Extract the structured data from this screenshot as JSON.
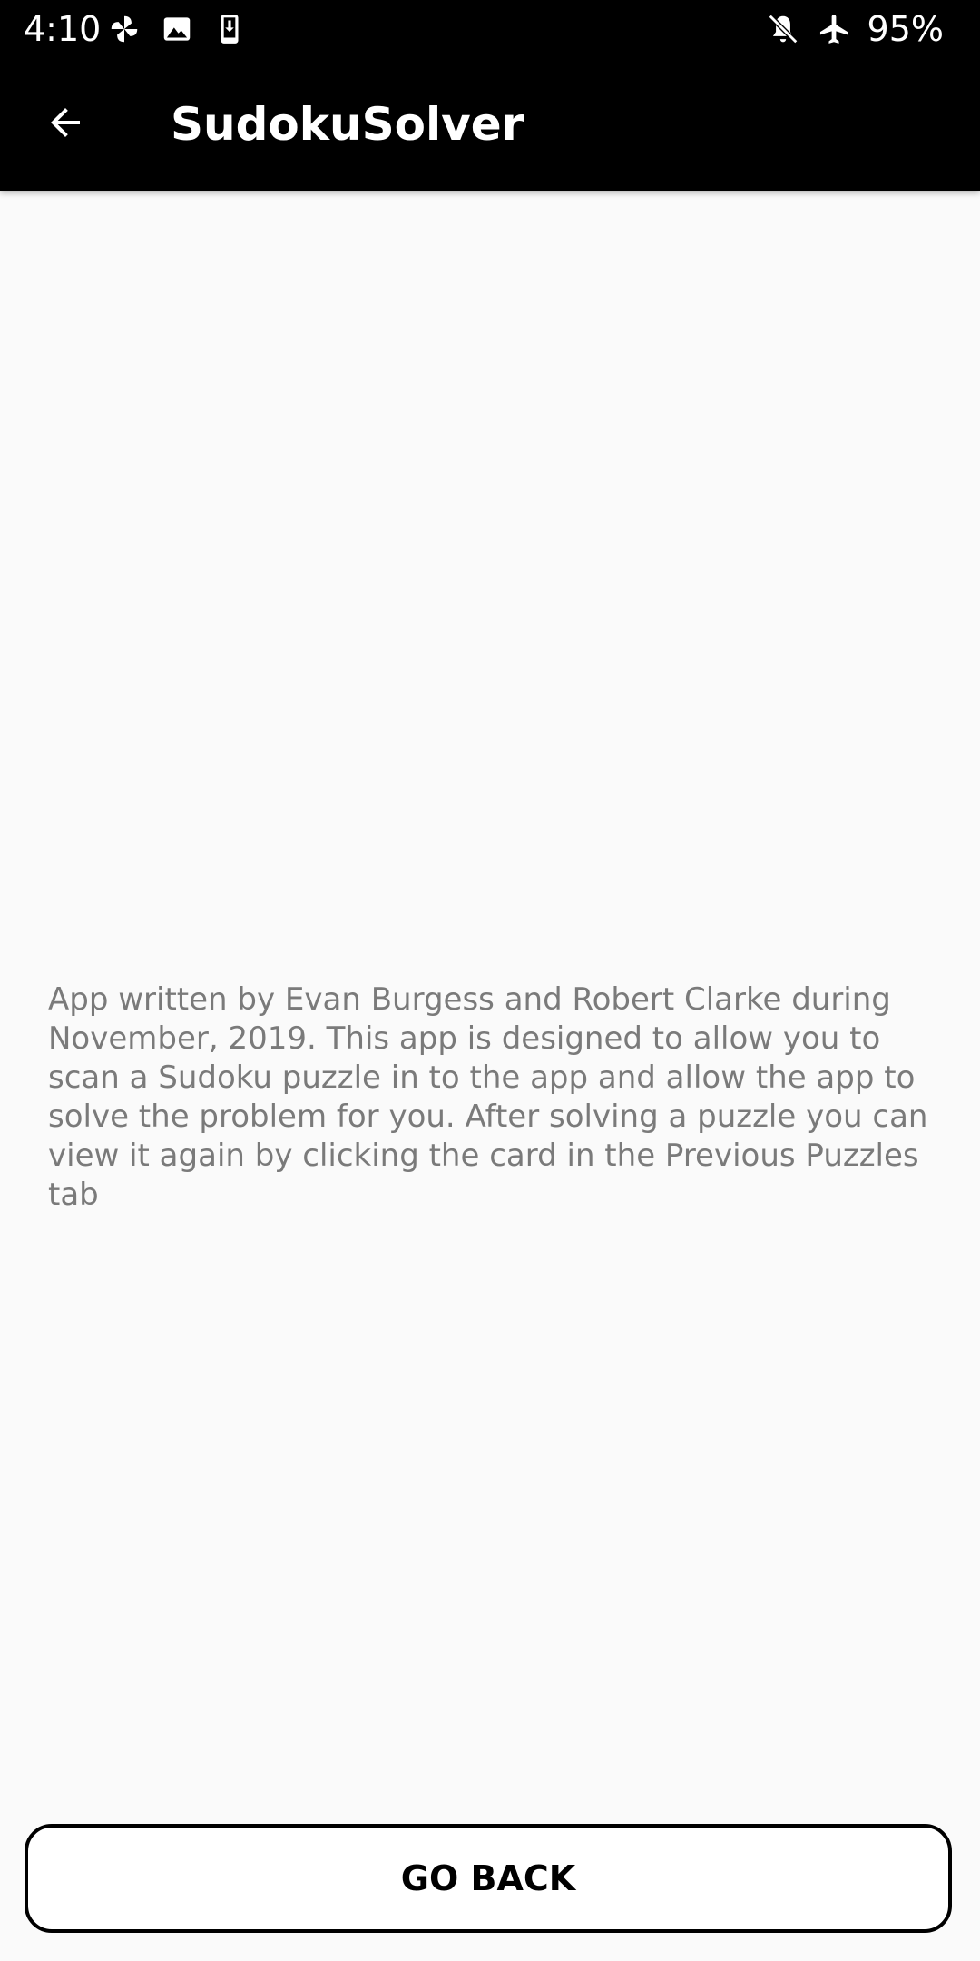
{
  "status_bar": {
    "time": "4:10",
    "battery": "95%",
    "left_icons": [
      "pinwheel-icon",
      "image-icon",
      "download-icon"
    ],
    "right_icons": [
      "notifications-off-icon",
      "airplane-mode-icon"
    ]
  },
  "app_bar": {
    "title": "SudokuSolver",
    "back_icon": "arrow-back-icon"
  },
  "content": {
    "about_text": "App written by Evan Burgess and Robert Clarke during November, 2019. This app is designed to allow you to scan a Sudoku puzzle in to the app and allow the app to solve the problem for you. After solving a puzzle you can view it again by clicking the card in the Previous Puzzles tab"
  },
  "actions": {
    "go_back_label": "GO BACK"
  },
  "colors": {
    "background": "#fafafa",
    "app_bar": "#000000",
    "body_text": "#7a7a7a"
  }
}
